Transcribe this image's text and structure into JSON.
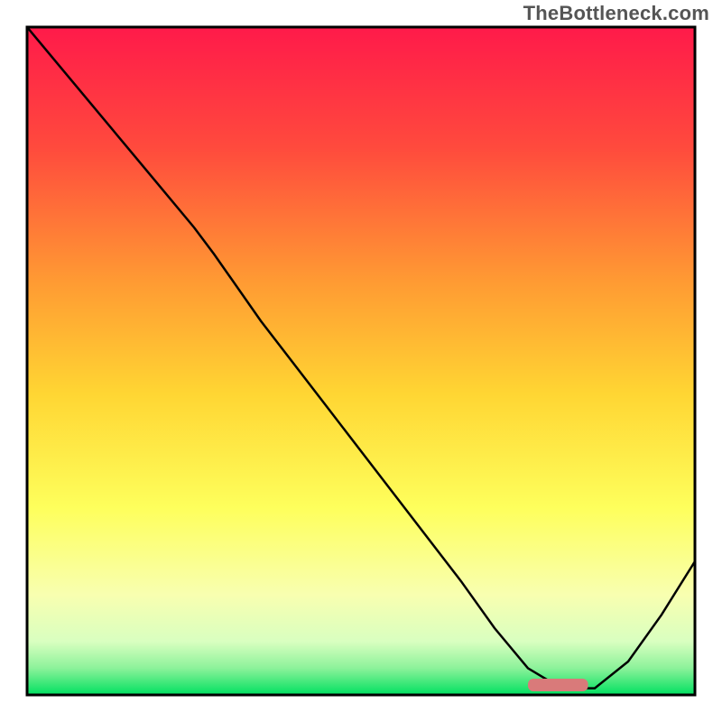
{
  "watermark": "TheBottleneck.com",
  "chart_data": {
    "type": "line",
    "title": "",
    "xlabel": "",
    "ylabel": "",
    "xlim": [
      0,
      100
    ],
    "ylim": [
      0,
      100
    ],
    "grid": false,
    "series": [
      {
        "name": "bottleneck-curve",
        "x": [
          0,
          5,
          10,
          15,
          20,
          25,
          28,
          35,
          45,
          55,
          65,
          70,
          75,
          80,
          85,
          90,
          95,
          100
        ],
        "y": [
          100,
          94,
          88,
          82,
          76,
          70,
          66,
          56,
          43,
          30,
          17,
          10,
          4,
          1,
          1,
          5,
          12,
          20
        ]
      }
    ],
    "highlight_segment": {
      "name": "optimal-range",
      "x_start": 75,
      "x_end": 84,
      "color": "#d97a7a"
    },
    "background_gradient": {
      "top": "#ff1a4a",
      "mid_upper": "#ff8a33",
      "mid": "#ffd633",
      "mid_lower": "#fff95c",
      "lower": "#f5ffb8",
      "bottom": "#00e060"
    }
  }
}
